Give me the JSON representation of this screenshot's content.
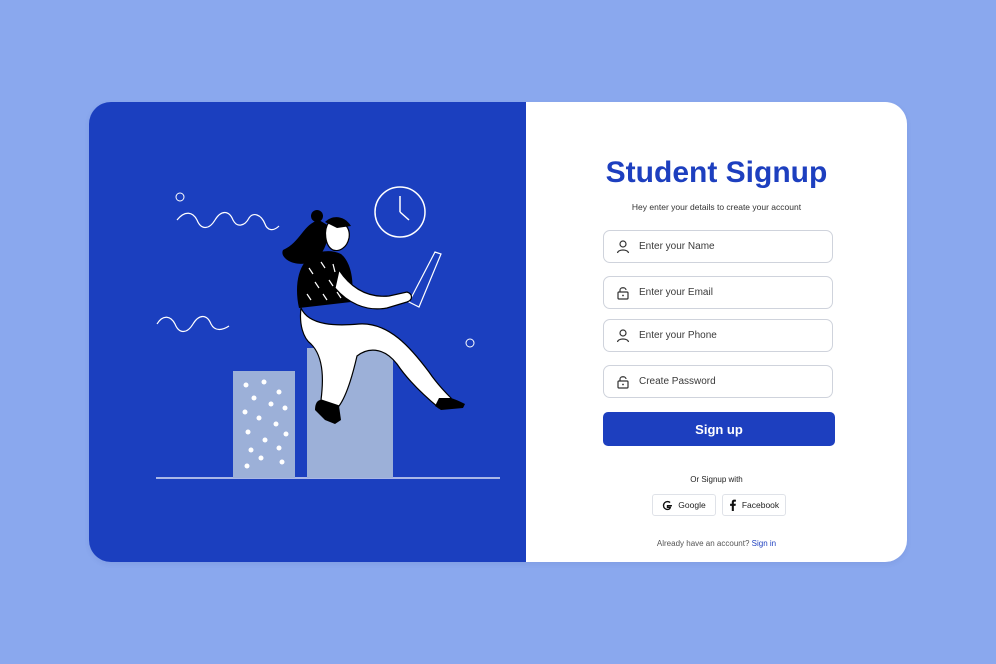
{
  "form": {
    "title": "Student Signup",
    "subtitle": "Hey enter your details to create your account",
    "fields": [
      {
        "placeholder": "Enter your Name",
        "icon": "user-icon",
        "value": ""
      },
      {
        "placeholder": "Enter your Email",
        "icon": "lock-icon",
        "value": ""
      },
      {
        "placeholder": "Enter your Phone",
        "icon": "user-icon",
        "value": ""
      },
      {
        "placeholder": "Create Password",
        "icon": "lock-icon",
        "value": ""
      }
    ],
    "submit_label": "Sign up",
    "or_text": "Or Signup with",
    "google_label": "Google",
    "facebook_label": "Facebook",
    "already_text": "Already have an account?",
    "signin_label": "Sign in"
  },
  "colors": {
    "background": "#8aa8ee",
    "brand_blue": "#1d3fbf",
    "panel": "#1b3fbf",
    "block_light": "#9cb0d8"
  },
  "illustration": {
    "description_icons": [
      "clock-icon",
      "squiggle-line",
      "woman-with-laptop",
      "block"
    ]
  }
}
